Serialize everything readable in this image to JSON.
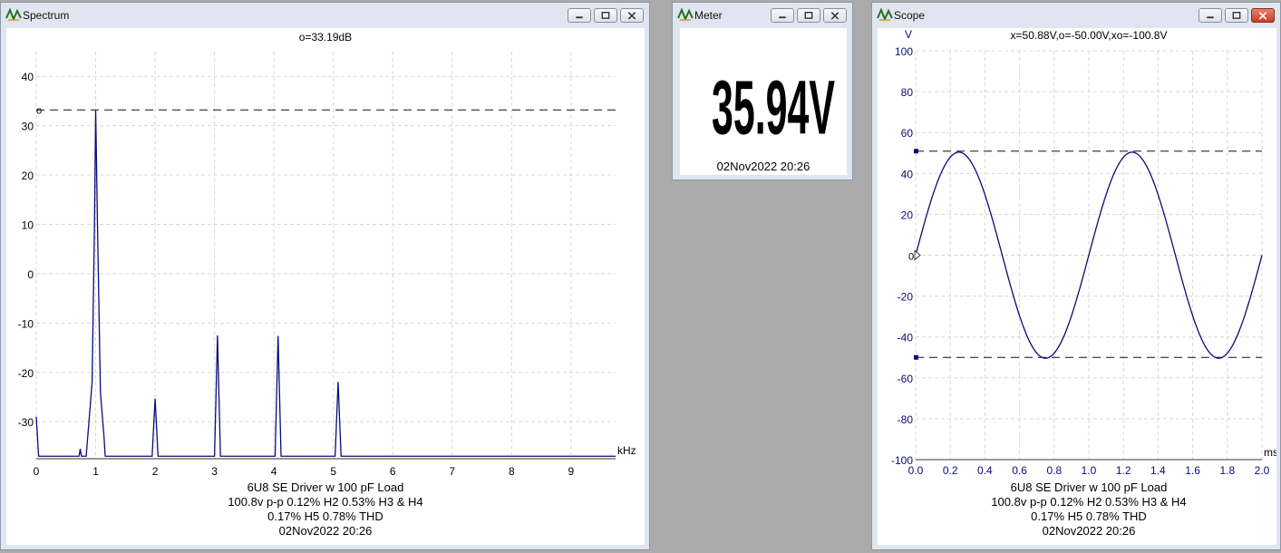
{
  "spectrum": {
    "title": "Spectrum",
    "readout": "o=33.19dB",
    "cursor_label": "o",
    "x_unit": "kHz",
    "x_ticks": [
      "0",
      "1",
      "2",
      "3",
      "4",
      "5",
      "6",
      "7",
      "8",
      "9"
    ],
    "y_ticks": [
      "40",
      "30",
      "20",
      "10",
      "0",
      "-10",
      "-20",
      "-30"
    ],
    "caption": [
      "6U8 SE Driver w 100 pF Load",
      "100.8v p-p 0.12% H2  0.53% H3 & H4",
      "0.17% H5 0.78% THD",
      "02Nov2022  20:26"
    ]
  },
  "meter": {
    "title": "Meter",
    "value": "35.94V",
    "timestamp": "02Nov2022  20:26"
  },
  "scope": {
    "title": "Scope",
    "y_unit": "V",
    "readout": "x=50.88V,o=-50.00V,xo=-100.8V",
    "x_unit": "ms",
    "cursor_label": "0",
    "x_ticks": [
      "0.0",
      "0.2",
      "0.4",
      "0.6",
      "0.8",
      "1.0",
      "1.2",
      "1.4",
      "1.6",
      "1.8",
      "2.0"
    ],
    "y_ticks": [
      "100",
      "80",
      "60",
      "40",
      "20",
      "0",
      "-20",
      "-40",
      "-60",
      "-80",
      "-100"
    ],
    "caption": [
      "6U8 SE Driver w 100 pF Load",
      "100.8v p-p 0.12% H2  0.53% H3 & H4",
      "0.17% H5 0.78% THD",
      "02Nov2022  20:26"
    ]
  },
  "chart_data": [
    {
      "type": "line",
      "title": "Spectrum",
      "xlabel": "kHz",
      "ylabel": "",
      "xlim": [
        0,
        9.75
      ],
      "ylim": [
        -37.5,
        45
      ],
      "grid": true,
      "cursor_level": 33.19,
      "peaks": [
        {
          "x": 1.0,
          "y": 33.19
        },
        {
          "x": 2.0,
          "y": -25.3
        },
        {
          "x": 3.05,
          "y": -12.5
        },
        {
          "x": 4.07,
          "y": -12.6
        },
        {
          "x": 5.08,
          "y": -21.9
        }
      ]
    },
    {
      "type": "line",
      "title": "Scope",
      "xlabel": "ms",
      "ylabel": "V",
      "xlim": [
        0,
        2.0
      ],
      "ylim": [
        -100,
        100
      ],
      "grid": true,
      "amplitude": 50.4,
      "frequency_khz": 1.0,
      "phase_offset_ms": 0.0,
      "cursor_levels": [
        50.88,
        -50.0
      ]
    }
  ]
}
